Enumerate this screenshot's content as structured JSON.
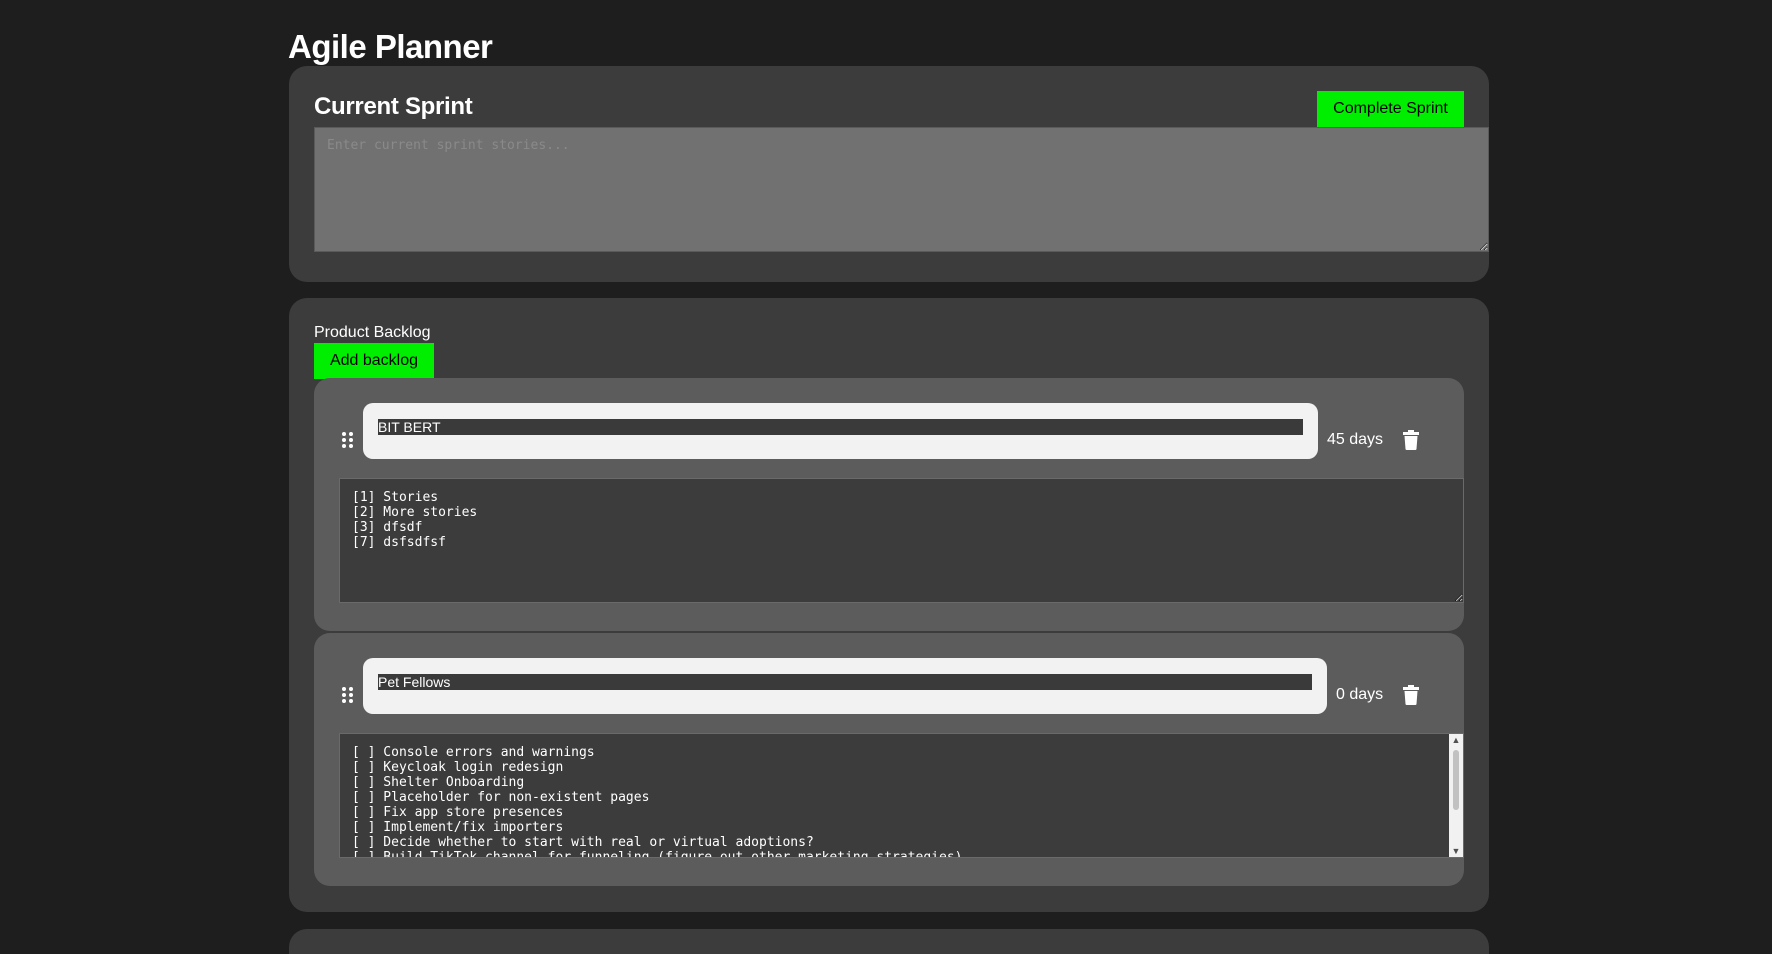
{
  "app": {
    "title": "Agile Planner"
  },
  "sprint": {
    "title": "Current Sprint",
    "complete_label": "Complete Sprint",
    "placeholder": "Enter current sprint stories...",
    "value": ""
  },
  "backlog": {
    "label": "Product Backlog",
    "add_label": "Add backlog",
    "items": [
      {
        "name": "BIT BERT",
        "days": "45 days",
        "stories": "[1] Stories\n[2] More stories\n[3] dfsdf\n[7] dsfsdfsf"
      },
      {
        "name": "Pet Fellows",
        "days": "0 days",
        "stories": "[ ] Console errors and warnings\n[ ] Keycloak login redesign\n[ ] Shelter Onboarding\n[ ] Placeholder for non-existent pages\n[ ] Fix app store presences\n[ ] Implement/fix importers\n[ ] Decide whether to start with real or virtual adoptions?\n[ ] Build TikTok channel for funneling (figure out other marketing strategies)"
      }
    ]
  },
  "icons": {
    "drag": "drag-handle-icon",
    "delete": "trash-icon"
  },
  "colors": {
    "background": "#1e1e1e",
    "panel": "#3c3c3c",
    "card": "#5c5c5c",
    "accent_green": "#00ee00"
  }
}
